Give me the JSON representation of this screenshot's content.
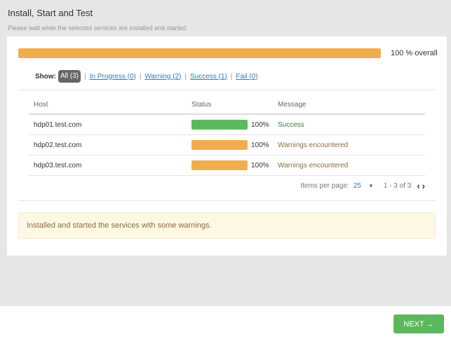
{
  "page": {
    "title": "Install, Start and Test",
    "subtitle": "Please wait while the selected services are installed and started."
  },
  "overall": {
    "progress_percent": 100,
    "label": "100 % overall",
    "bar_color": "#f0ad4e"
  },
  "filters": {
    "label": "Show:",
    "items": [
      {
        "label": "All (3)",
        "active": true
      },
      {
        "label": "In Progress (0)",
        "active": false
      },
      {
        "label": "Warning (2)",
        "active": false
      },
      {
        "label": "Success (1)",
        "active": false
      },
      {
        "label": "Fail (0)",
        "active": false
      }
    ],
    "separator": "|"
  },
  "table": {
    "columns": {
      "host": "Host",
      "status": "Status",
      "message": "Message"
    },
    "rows": [
      {
        "host": "hdp01.test.com",
        "progress": 100,
        "progress_label": "100%",
        "bar_color": "#5cb85c",
        "message": "Success",
        "message_type": "success"
      },
      {
        "host": "hdp02.test.com",
        "progress": 100,
        "progress_label": "100%",
        "bar_color": "#f0ad4e",
        "message": "Warnings encountered",
        "message_type": "warning"
      },
      {
        "host": "hdp03.test.com",
        "progress": 100,
        "progress_label": "100%",
        "bar_color": "#f0ad4e",
        "message": "Warnings encountered",
        "message_type": "warning"
      }
    ]
  },
  "pagination": {
    "items_per_page_label": "Items per page:",
    "items_per_page_value": "25",
    "caret": "▼",
    "range": "1 - 3 of 3",
    "prev_icon": "‹",
    "next_icon": "›"
  },
  "alert": {
    "text": "Installed and started the services with some warnings."
  },
  "footer": {
    "next_label": "NEXT →",
    "next_color": "#5cb85c"
  }
}
